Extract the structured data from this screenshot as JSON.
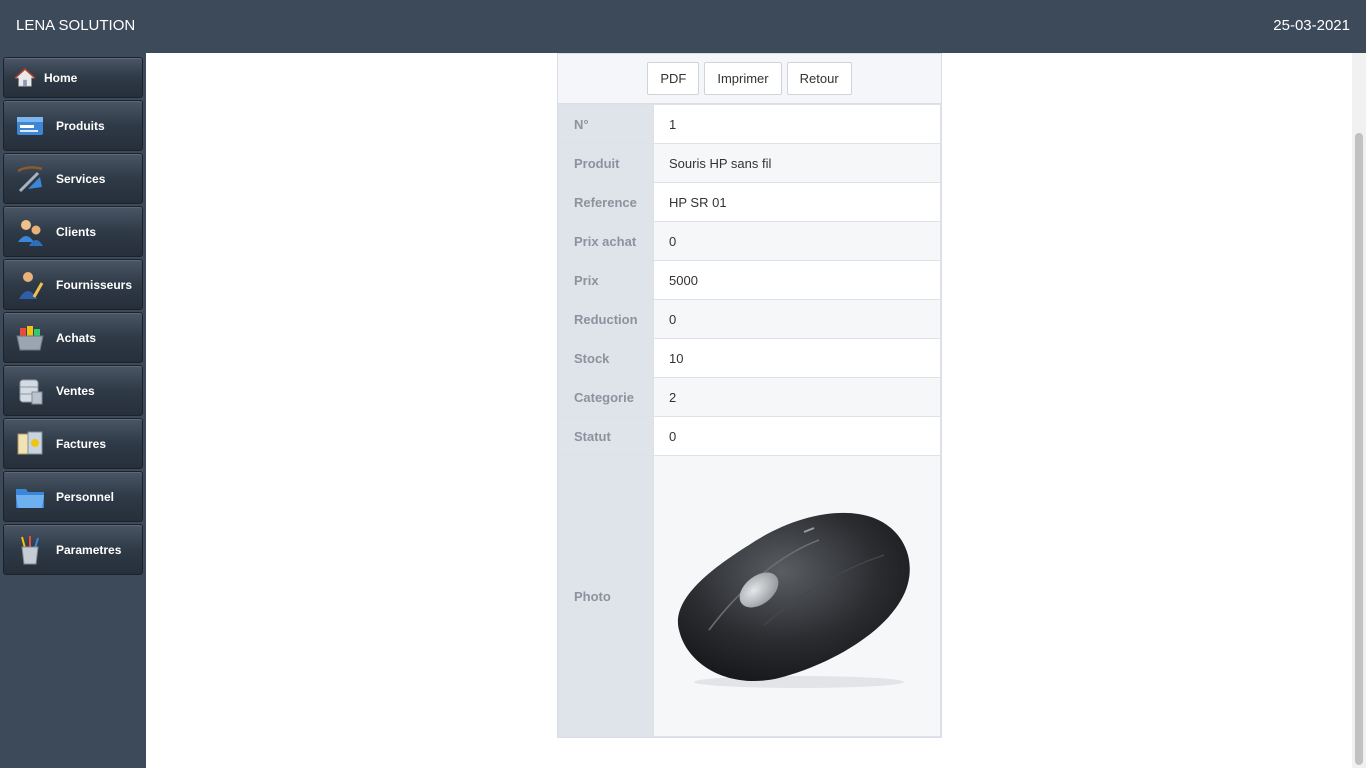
{
  "header": {
    "brand": "LENA SOLUTION",
    "date": "25-03-2021"
  },
  "sidebar": {
    "items": [
      {
        "label": "Home",
        "icon": "house-icon"
      },
      {
        "label": "Produits",
        "icon": "box-icon"
      },
      {
        "label": "Services",
        "icon": "tools-icon"
      },
      {
        "label": "Clients",
        "icon": "users-icon"
      },
      {
        "label": "Fournisseurs",
        "icon": "supplier-icon"
      },
      {
        "label": "Achats",
        "icon": "basket-icon"
      },
      {
        "label": "Ventes",
        "icon": "database-icon"
      },
      {
        "label": "Factures",
        "icon": "invoice-icon"
      },
      {
        "label": "Personnel",
        "icon": "folder-icon"
      },
      {
        "label": "Parametres",
        "icon": "pencil-cup-icon"
      }
    ]
  },
  "actions": {
    "pdf": "PDF",
    "print": "Imprimer",
    "back": "Retour"
  },
  "details": {
    "rows": [
      {
        "label": "N°",
        "value": "1"
      },
      {
        "label": "Produit",
        "value": "Souris HP sans fil"
      },
      {
        "label": "Reference",
        "value": "HP SR 01"
      },
      {
        "label": "Prix achat",
        "value": "0"
      },
      {
        "label": "Prix",
        "value": "5000"
      },
      {
        "label": "Reduction",
        "value": "0"
      },
      {
        "label": "Stock",
        "value": "10"
      },
      {
        "label": "Categorie",
        "value": "2"
      },
      {
        "label": "Statut",
        "value": "0"
      }
    ],
    "photo_label": "Photo"
  },
  "colors": {
    "chrome": "#3d4a5a",
    "key_cell": "#dfe3ea"
  }
}
